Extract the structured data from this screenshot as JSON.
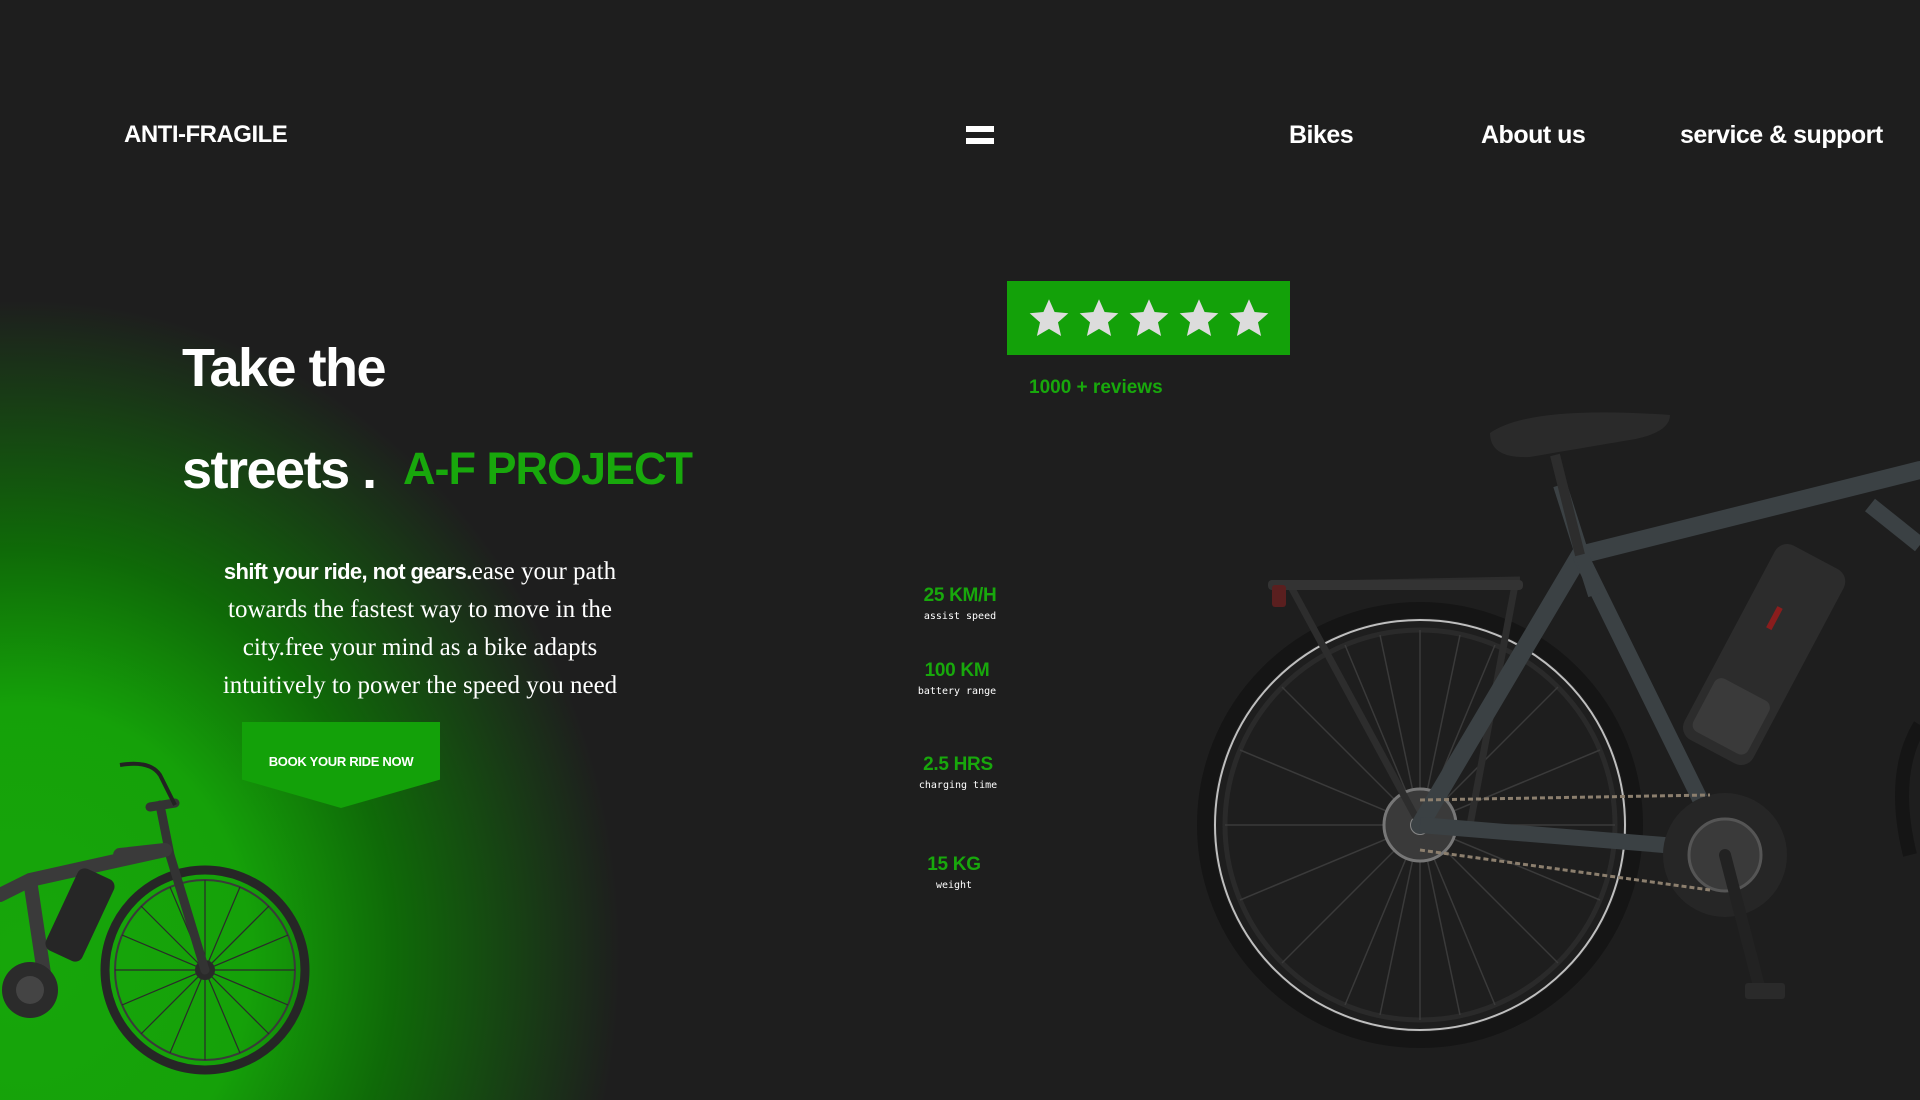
{
  "header": {
    "brand": "ANTI-FRAGILE",
    "menu_icon": "hamburger-icon",
    "nav": [
      {
        "label": "Bikes"
      },
      {
        "label": "About us"
      },
      {
        "label": "service & support"
      }
    ]
  },
  "rating": {
    "stars": 5,
    "star_icon": "star-icon",
    "reviews": "1000 + reviews"
  },
  "hero": {
    "line1": "Take the",
    "line2": "streets .",
    "project": "A-F PROJECT",
    "tagline_bold": "shift your ride, not gears.",
    "tagline_rest": "ease your path towards the fastest way to move in the city.free your mind as a bike adapts intuitively to power the speed you need",
    "cta": "BOOK YOUR RIDE NOW"
  },
  "specs": [
    {
      "value": "25 KM/H",
      "label": "assist speed"
    },
    {
      "value": "100 KM",
      "label": "battery range"
    },
    {
      "value": "2.5 HRS",
      "label": "charging time"
    },
    {
      "value": "15 KG",
      "label": "weight"
    }
  ],
  "colors": {
    "background": "#1e1e1e",
    "accent": "#13a109",
    "text": "#ffffff"
  }
}
